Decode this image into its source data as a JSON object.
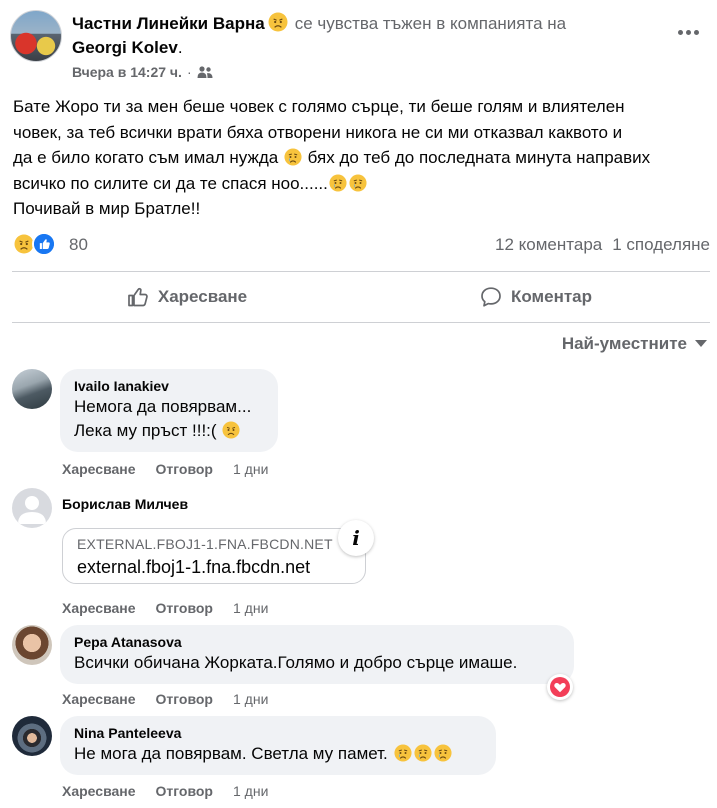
{
  "post": {
    "page_name": "Частни Линейки Варна",
    "feeling_text": "се чувства тъжен в компанията на",
    "tagged_name": "Georgi Kolev",
    "tagged_suffix": ".",
    "time": "Вчера в 14:27 ч.",
    "time_separator": "·",
    "audience_icon": "friends-icon",
    "body_lines": [
      "Бате Жоро ти за мен беше човек с голямо сърце, ти беше голям и влиятелен",
      "човек, за теб всички врати бяха отворени никога не си ми отказвал каквото и",
      "да е било когато съм имал нужда",
      "бях до теб до последната минута направих",
      "всичко по силите си да те спася ноо......",
      "Почивай в мир Братле!!"
    ],
    "reaction_count": "80",
    "comments_count": "12 коментара",
    "shares_count": "1 споделяне"
  },
  "actions": {
    "like_label": "Харесване",
    "comment_label": "Коментар"
  },
  "sort": {
    "label": "Най-уместните"
  },
  "comments": [
    {
      "author": "Ivailo Ianakiev",
      "lines": [
        "Немога да повярвам...",
        "Лека му пръст !!!:("
      ],
      "like_label": "Харесване",
      "reply_label": "Отговор",
      "age": "1 дни"
    },
    {
      "author": "Борислав Милчев",
      "link_host": "EXTERNAL.FBOJ1-1.FNA.FBCDN.NET",
      "link_url": "external.fboj1-1.fna.fbcdn.net",
      "info_glyph": "i",
      "like_label": "Харесване",
      "reply_label": "Отговор",
      "age": "1 дни"
    },
    {
      "author": "Pepa Atanasova",
      "lines": [
        "Всички обичана Жорката.Голямо и добро сърце имаше."
      ],
      "like_label": "Харесване",
      "reply_label": "Отговор",
      "age": "1 дни"
    },
    {
      "author": "Nina Panteleeva",
      "lines": [
        "Не мога да повярвам. Светла му памет."
      ],
      "like_label": "Харесване",
      "reply_label": "Отговор",
      "age": "1 дни"
    }
  ],
  "colors": {
    "text_primary": "#050505",
    "text_secondary": "#65676b",
    "bubble_bg": "#f0f2f5",
    "like_blue": "#1877f2",
    "love_red": "#f33e58",
    "sad_yellow": "#f7b125",
    "divider": "#ced0d4"
  }
}
